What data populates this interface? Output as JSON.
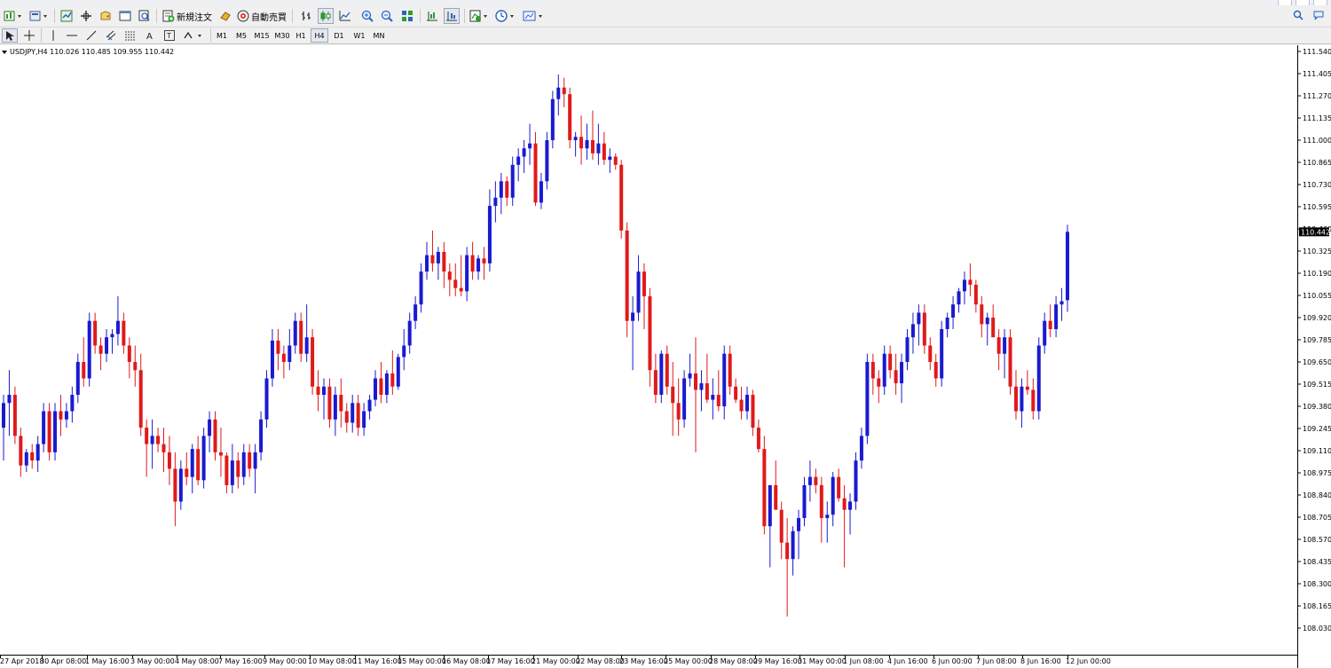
{
  "toolbar": {
    "new_order_label": "新規注文",
    "auto_trading_label": "自動売買"
  },
  "timeframes": [
    "M1",
    "M5",
    "M15",
    "M30",
    "H1",
    "H4",
    "D1",
    "W1",
    "MN"
  ],
  "active_timeframe": "H4",
  "chart_data": {
    "type": "candlestick",
    "symbol_header": "USDJPY,H4  110.026 110.485 109.955 110.442",
    "current_price_label": "110.442",
    "current_price": 110.442,
    "bull_color": "#1a1ad0",
    "bear_color": "#e01a1a",
    "ylim": [
      108.03,
      111.58
    ],
    "y_ticks": [
      "111.540",
      "111.405",
      "111.270",
      "111.135",
      "111.000",
      "110.865",
      "110.730",
      "110.595",
      "110.460",
      "110.325",
      "110.190",
      "110.055",
      "109.920",
      "109.785",
      "109.650",
      "109.515",
      "109.380",
      "109.245",
      "109.110",
      "108.975",
      "108.840",
      "108.705",
      "108.570",
      "108.435",
      "108.300",
      "108.165",
      "108.030"
    ],
    "x_ticks": [
      "27 Apr 2018",
      "30 Apr 08:00",
      "1 May 16:00",
      "3 May 00:00",
      "4 May 08:00",
      "7 May 16:00",
      "9 May 00:00",
      "10 May 08:00",
      "11 May 16:00",
      "15 May 00:00",
      "16 May 08:00",
      "17 May 16:00",
      "21 May 00:00",
      "22 May 08:00",
      "23 May 16:00",
      "25 May 00:00",
      "28 May 08:00",
      "29 May 16:00",
      "31 May 00:00",
      "1 Jun 08:00",
      "4 Jun 16:00",
      "6 Jun 00:00",
      "7 Jun 08:00",
      "8 Jun 16:00",
      "12 Jun 00:00"
    ],
    "candles": [
      [
        109.25,
        109.45,
        109.05,
        109.4
      ],
      [
        109.4,
        109.6,
        109.2,
        109.45
      ],
      [
        109.45,
        109.5,
        109.15,
        109.2
      ],
      [
        109.2,
        109.25,
        108.95,
        109.02
      ],
      [
        109.02,
        109.12,
        108.98,
        109.1
      ],
      [
        109.1,
        109.15,
        109.0,
        109.05
      ],
      [
        109.05,
        109.2,
        108.98,
        109.15
      ],
      [
        109.15,
        109.4,
        109.1,
        109.35
      ],
      [
        109.35,
        109.4,
        109.05,
        109.1
      ],
      [
        109.1,
        109.4,
        109.05,
        109.35
      ],
      [
        109.35,
        109.45,
        109.2,
        109.3
      ],
      [
        109.3,
        109.4,
        109.25,
        109.35
      ],
      [
        109.35,
        109.5,
        109.28,
        109.45
      ],
      [
        109.45,
        109.7,
        109.4,
        109.65
      ],
      [
        109.65,
        109.8,
        109.5,
        109.55
      ],
      [
        109.55,
        109.95,
        109.5,
        109.9
      ],
      [
        109.9,
        109.95,
        109.7,
        109.75
      ],
      [
        109.75,
        109.8,
        109.6,
        109.7
      ],
      [
        109.7,
        109.85,
        109.65,
        109.8
      ],
      [
        109.8,
        109.85,
        109.7,
        109.82
      ],
      [
        109.82,
        110.05,
        109.75,
        109.9
      ],
      [
        109.9,
        109.95,
        109.7,
        109.75
      ],
      [
        109.75,
        109.8,
        109.55,
        109.65
      ],
      [
        109.65,
        109.75,
        109.5,
        109.6
      ],
      [
        109.6,
        109.7,
        109.2,
        109.25
      ],
      [
        109.25,
        109.3,
        108.95,
        109.15
      ],
      [
        109.15,
        109.3,
        109.0,
        109.2
      ],
      [
        109.2,
        109.25,
        109.1,
        109.15
      ],
      [
        109.15,
        109.25,
        108.98,
        109.1
      ],
      [
        109.1,
        109.2,
        108.9,
        109.0
      ],
      [
        109.0,
        109.1,
        108.65,
        108.8
      ],
      [
        108.8,
        109.05,
        108.75,
        109.0
      ],
      [
        109.0,
        109.1,
        108.9,
        108.95
      ],
      [
        108.95,
        109.15,
        108.85,
        109.12
      ],
      [
        109.12,
        109.2,
        108.9,
        108.93
      ],
      [
        108.93,
        109.25,
        108.88,
        109.2
      ],
      [
        109.2,
        109.35,
        109.1,
        109.3
      ],
      [
        109.3,
        109.35,
        109.05,
        109.1
      ],
      [
        109.1,
        109.25,
        108.95,
        109.08
      ],
      [
        109.08,
        109.1,
        108.85,
        108.9
      ],
      [
        108.9,
        109.15,
        108.85,
        109.05
      ],
      [
        109.05,
        109.1,
        108.88,
        108.95
      ],
      [
        108.95,
        109.15,
        108.9,
        109.1
      ],
      [
        109.1,
        109.15,
        108.95,
        109.0
      ],
      [
        109.0,
        109.15,
        108.85,
        109.1
      ],
      [
        109.1,
        109.35,
        109.05,
        109.3
      ],
      [
        109.3,
        109.6,
        109.25,
        109.55
      ],
      [
        109.55,
        109.85,
        109.5,
        109.78
      ],
      [
        109.78,
        109.85,
        109.6,
        109.7
      ],
      [
        109.7,
        109.75,
        109.55,
        109.65
      ],
      [
        109.65,
        109.85,
        109.6,
        109.75
      ],
      [
        109.75,
        109.95,
        109.7,
        109.9
      ],
      [
        109.9,
        109.95,
        109.65,
        109.7
      ],
      [
        109.7,
        110.0,
        109.65,
        109.8
      ],
      [
        109.8,
        109.85,
        109.45,
        109.5
      ],
      [
        109.5,
        109.6,
        109.35,
        109.45
      ],
      [
        109.45,
        109.55,
        109.3,
        109.5
      ],
      [
        109.5,
        109.55,
        109.25,
        109.3
      ],
      [
        109.3,
        109.5,
        109.2,
        109.45
      ],
      [
        109.45,
        109.55,
        109.25,
        109.35
      ],
      [
        109.35,
        109.4,
        109.22,
        109.28
      ],
      [
        109.28,
        109.45,
        109.22,
        109.4
      ],
      [
        109.4,
        109.45,
        109.2,
        109.25
      ],
      [
        109.25,
        109.4,
        109.2,
        109.35
      ],
      [
        109.35,
        109.45,
        109.3,
        109.42
      ],
      [
        109.42,
        109.6,
        109.38,
        109.55
      ],
      [
        109.55,
        109.65,
        109.4,
        109.45
      ],
      [
        109.45,
        109.6,
        109.4,
        109.58
      ],
      [
        109.58,
        109.72,
        109.45,
        109.5
      ],
      [
        109.5,
        109.7,
        109.48,
        109.68
      ],
      [
        109.68,
        109.85,
        109.6,
        109.75
      ],
      [
        109.75,
        109.95,
        109.7,
        109.9
      ],
      [
        109.9,
        110.05,
        109.85,
        110.0
      ],
      [
        110.0,
        110.25,
        109.95,
        110.2
      ],
      [
        110.2,
        110.38,
        110.15,
        110.3
      ],
      [
        110.3,
        110.45,
        110.2,
        110.25
      ],
      [
        110.25,
        110.35,
        110.15,
        110.32
      ],
      [
        110.32,
        110.38,
        110.1,
        110.2
      ],
      [
        110.2,
        110.25,
        110.05,
        110.15
      ],
      [
        110.15,
        110.25,
        110.05,
        110.1
      ],
      [
        110.1,
        110.3,
        110.05,
        110.08
      ],
      [
        110.08,
        110.35,
        110.02,
        110.3
      ],
      [
        110.3,
        110.38,
        110.15,
        110.2
      ],
      [
        110.2,
        110.3,
        110.15,
        110.28
      ],
      [
        110.28,
        110.35,
        110.15,
        110.25
      ],
      [
        110.25,
        110.7,
        110.2,
        110.6
      ],
      [
        110.6,
        110.75,
        110.5,
        110.65
      ],
      [
        110.65,
        110.8,
        110.55,
        110.75
      ],
      [
        110.75,
        110.78,
        110.6,
        110.65
      ],
      [
        110.65,
        110.9,
        110.6,
        110.85
      ],
      [
        110.85,
        110.95,
        110.75,
        110.9
      ],
      [
        110.9,
        111.0,
        110.8,
        110.95
      ],
      [
        110.95,
        111.1,
        110.85,
        110.98
      ],
      [
        110.98,
        111.05,
        110.6,
        110.62
      ],
      [
        110.62,
        110.8,
        110.58,
        110.75
      ],
      [
        110.75,
        111.05,
        110.7,
        111.0
      ],
      [
        111.0,
        111.3,
        110.95,
        111.25
      ],
      [
        111.25,
        111.4,
        111.15,
        111.32
      ],
      [
        111.32,
        111.38,
        111.2,
        111.28
      ],
      [
        111.28,
        111.32,
        110.95,
        111.0
      ],
      [
        111.0,
        111.05,
        110.9,
        111.02
      ],
      [
        111.02,
        111.15,
        110.85,
        110.95
      ],
      [
        110.95,
        111.1,
        110.88,
        111.0
      ],
      [
        111.0,
        111.18,
        110.88,
        110.92
      ],
      [
        110.92,
        111.1,
        110.85,
        110.98
      ],
      [
        110.98,
        111.05,
        110.85,
        110.88
      ],
      [
        110.88,
        110.95,
        110.8,
        110.9
      ],
      [
        110.9,
        110.92,
        110.82,
        110.85
      ],
      [
        110.85,
        110.88,
        110.4,
        110.45
      ],
      [
        110.45,
        110.5,
        109.8,
        109.9
      ],
      [
        109.9,
        110.05,
        109.6,
        109.95
      ],
      [
        109.95,
        110.3,
        109.9,
        110.2
      ],
      [
        110.2,
        110.25,
        109.85,
        110.05
      ],
      [
        110.05,
        110.1,
        109.5,
        109.6
      ],
      [
        109.6,
        109.7,
        109.4,
        109.45
      ],
      [
        109.45,
        109.72,
        109.4,
        109.7
      ],
      [
        109.7,
        109.75,
        109.45,
        109.5
      ],
      [
        109.5,
        109.65,
        109.2,
        109.4
      ],
      [
        109.4,
        109.55,
        109.2,
        109.3
      ],
      [
        109.3,
        109.6,
        109.25,
        109.55
      ],
      [
        109.55,
        109.7,
        109.5,
        109.58
      ],
      [
        109.58,
        109.8,
        109.1,
        109.48
      ],
      [
        109.48,
        109.6,
        109.35,
        109.52
      ],
      [
        109.52,
        109.7,
        109.4,
        109.42
      ],
      [
        109.42,
        109.55,
        109.3,
        109.45
      ],
      [
        109.45,
        109.6,
        109.35,
        109.38
      ],
      [
        109.38,
        109.75,
        109.3,
        109.7
      ],
      [
        109.7,
        109.75,
        109.45,
        109.5
      ],
      [
        109.5,
        109.55,
        109.4,
        109.42
      ],
      [
        109.42,
        109.5,
        109.3,
        109.35
      ],
      [
        109.35,
        109.5,
        109.3,
        109.45
      ],
      [
        109.45,
        109.48,
        109.2,
        109.25
      ],
      [
        109.25,
        109.3,
        109.1,
        109.12
      ],
      [
        109.12,
        109.2,
        108.6,
        108.65
      ],
      [
        108.65,
        108.75,
        108.4,
        108.9
      ],
      [
        108.9,
        109.05,
        108.85,
        108.75
      ],
      [
        108.75,
        108.8,
        108.45,
        108.55
      ],
      [
        108.55,
        108.7,
        108.1,
        108.45
      ],
      [
        108.45,
        108.65,
        108.35,
        108.62
      ],
      [
        108.62,
        108.75,
        108.45,
        108.7
      ],
      [
        108.7,
        108.95,
        108.65,
        108.9
      ],
      [
        108.9,
        109.05,
        108.8,
        108.95
      ],
      [
        108.95,
        109.0,
        108.85,
        108.9
      ],
      [
        108.9,
        108.95,
        108.55,
        108.7
      ],
      [
        108.7,
        108.8,
        108.55,
        108.72
      ],
      [
        108.72,
        108.98,
        108.65,
        108.95
      ],
      [
        108.95,
        109.0,
        108.8,
        108.82
      ],
      [
        108.82,
        108.9,
        108.4,
        108.75
      ],
      [
        108.75,
        108.85,
        108.6,
        108.8
      ],
      [
        108.8,
        109.1,
        108.75,
        109.05
      ],
      [
        109.05,
        109.25,
        109.0,
        109.2
      ],
      [
        109.2,
        109.7,
        109.15,
        109.65
      ],
      [
        109.65,
        109.7,
        109.45,
        109.55
      ],
      [
        109.55,
        109.6,
        109.4,
        109.5
      ],
      [
        109.5,
        109.75,
        109.45,
        109.7
      ],
      [
        109.7,
        109.75,
        109.55,
        109.6
      ],
      [
        109.6,
        109.7,
        109.45,
        109.52
      ],
      [
        109.52,
        109.7,
        109.4,
        109.65
      ],
      [
        109.65,
        109.85,
        109.6,
        109.8
      ],
      [
        109.8,
        109.95,
        109.7,
        109.88
      ],
      [
        109.88,
        110.0,
        109.75,
        109.95
      ],
      [
        109.95,
        110.0,
        109.7,
        109.75
      ],
      [
        109.75,
        109.8,
        109.6,
        109.65
      ],
      [
        109.65,
        109.7,
        109.5,
        109.55
      ],
      [
        109.55,
        109.9,
        109.5,
        109.85
      ],
      [
        109.85,
        109.95,
        109.8,
        109.92
      ],
      [
        109.92,
        110.05,
        109.85,
        110.0
      ],
      [
        110.0,
        110.1,
        109.95,
        110.08
      ],
      [
        110.08,
        110.2,
        110.0,
        110.15
      ],
      [
        110.15,
        110.25,
        110.05,
        110.12
      ],
      [
        110.12,
        110.15,
        109.95,
        110.0
      ],
      [
        110.0,
        110.05,
        109.8,
        109.88
      ],
      [
        109.88,
        109.95,
        109.75,
        109.92
      ],
      [
        109.92,
        110.0,
        109.85,
        109.8
      ],
      [
        109.8,
        109.85,
        109.6,
        109.7
      ],
      [
        109.7,
        109.85,
        109.55,
        109.8
      ],
      [
        109.8,
        109.85,
        109.45,
        109.5
      ],
      [
        109.5,
        109.6,
        109.3,
        109.35
      ],
      [
        109.35,
        109.55,
        109.25,
        109.5
      ],
      [
        109.5,
        109.6,
        109.45,
        109.48
      ],
      [
        109.48,
        109.55,
        109.3,
        109.35
      ],
      [
        109.35,
        109.8,
        109.3,
        109.75
      ],
      [
        109.75,
        109.95,
        109.7,
        109.9
      ],
      [
        109.9,
        110.0,
        109.8,
        109.85
      ],
      [
        109.85,
        110.05,
        109.8,
        110.0
      ],
      [
        110.0,
        110.1,
        109.9,
        110.02
      ],
      [
        110.026,
        110.485,
        109.955,
        110.442
      ]
    ]
  }
}
